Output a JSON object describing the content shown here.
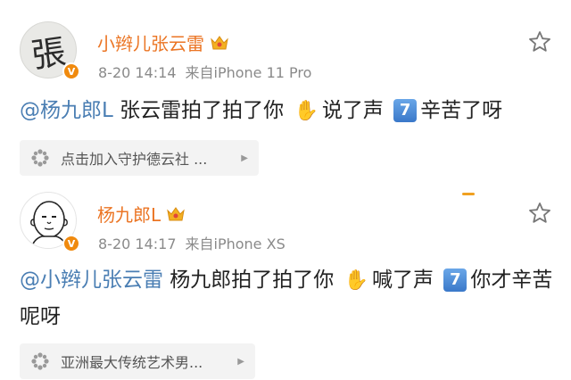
{
  "posts": [
    {
      "avatar_glyph": "張",
      "verified_badge": "V",
      "author": "小辫儿张云雷",
      "time": "8-20 14:14",
      "source": "来自iPhone 11 Pro",
      "mention": "@杨九郎L",
      "text_a": " 张云雷拍了拍了你",
      "text_b": "说了声",
      "number": "7",
      "text_c": "辛苦了呀",
      "card_label": "点击加入守护德云社 ..."
    },
    {
      "verified_badge": "V",
      "author": "杨九郎L",
      "time": "8-20 14:17",
      "source": "来自iPhone XS",
      "mention": "@小辫儿张云雷",
      "text_a": " 杨九郎拍了拍了你",
      "text_b": "喊了声",
      "number": "7",
      "text_c": "你才辛苦呢呀",
      "card_label": "亚洲最大传统艺术男..."
    }
  ],
  "icons": {
    "crown": "crown-icon",
    "star": "star-icon",
    "hand": "waving-hand-icon",
    "gear": "gear-icon",
    "arrow": "triangle-right-icon"
  },
  "colors": {
    "name": "#eb7524",
    "mention": "#4a7eb3",
    "badge": "#f08a0e"
  }
}
